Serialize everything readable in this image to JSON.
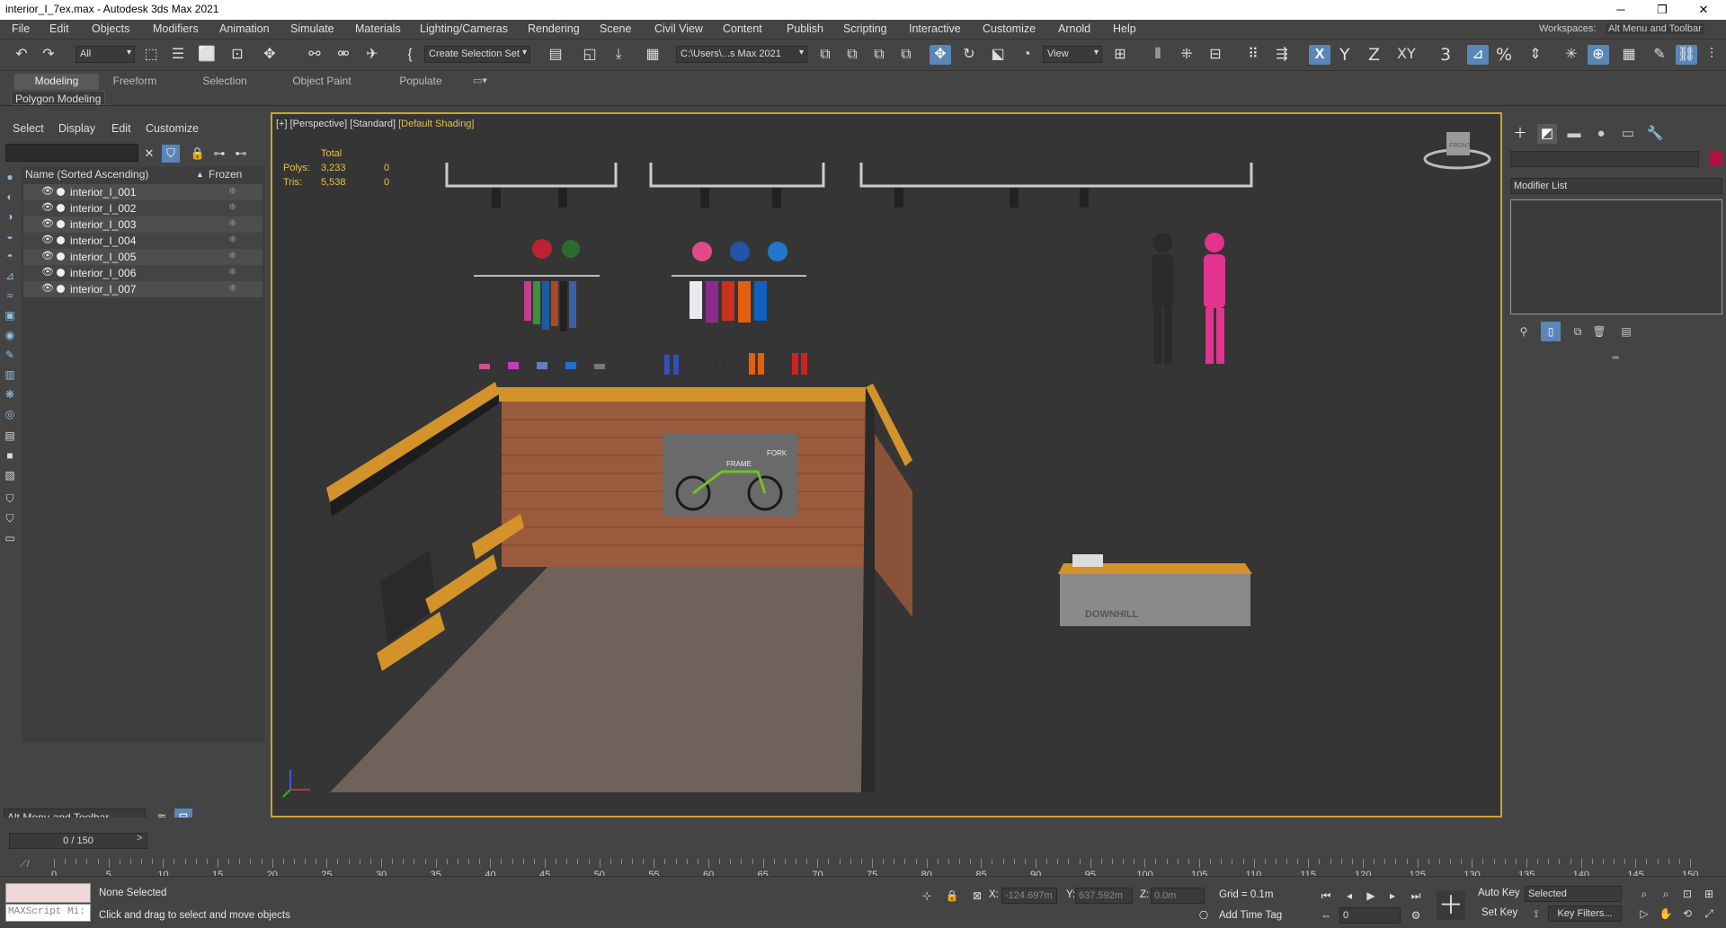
{
  "window": {
    "title": "interior_I_7ex.max - Autodesk 3ds Max 2021",
    "minimize": "─",
    "maximize": "❐",
    "close": "✕"
  },
  "menu": [
    "File",
    "Edit",
    "Objects",
    "Modifiers",
    "Animation",
    "Simulate",
    "Materials",
    "Lighting/Cameras",
    "Rendering",
    "Scene",
    "Civil View",
    "Content",
    "Publish",
    "Scripting",
    "Interactive",
    "Customize",
    "Arnold",
    "Help"
  ],
  "workspaces": {
    "label": "Workspaces:",
    "value": "Alt Menu and Toolbar"
  },
  "toolbar": {
    "filter": "All",
    "selection_set": "Create Selection Set",
    "path": "C:\\Users\\...s Max 2021",
    "ref_coord": "View",
    "axes": [
      "X",
      "Y",
      "Z",
      "XY"
    ],
    "snap_labels": [
      "3",
      "%"
    ]
  },
  "ribbon": {
    "tabs": [
      "Modeling",
      "Freeform",
      "Selection",
      "Object Paint",
      "Populate"
    ],
    "active_tab": "Modeling",
    "panel": "Polygon Modeling"
  },
  "explorer": {
    "menus": [
      "Select",
      "Display",
      "Edit",
      "Customize"
    ],
    "col_name": "Name (Sorted Ascending)",
    "col_frozen": "Frozen",
    "sort_marker": "▲",
    "objects": [
      "interior_I_001",
      "interior_I_002",
      "interior_I_003",
      "interior_I_004",
      "interior_I_005",
      "interior_I_006",
      "interior_I_007"
    ],
    "workspace_dd": "Alt Menu and Toolbar"
  },
  "viewport": {
    "label_plus": "[+]",
    "label_view": "[Perspective]",
    "label_std": "[Standard]",
    "label_shading": "[Default Shading]",
    "stats": {
      "header": "Total",
      "polys_label": "Polys:",
      "polys_total": "3,233",
      "polys_sel": "0",
      "tris_label": "Tris:",
      "tris_total": "5,538",
      "tris_sel": "0"
    },
    "counter_logo": "DOWNHILL",
    "board_labels": [
      "FRAME",
      "FORK"
    ],
    "cube_label": "FRONT"
  },
  "command_panel": {
    "modifier_list": "Modifier List",
    "color": "#b0123f"
  },
  "timeline": {
    "slider": "0 / 150",
    "ticks": [
      0,
      5,
      10,
      15,
      20,
      25,
      30,
      35,
      40,
      45,
      50,
      55,
      60,
      65,
      70,
      75,
      80,
      85,
      90,
      95,
      100,
      105,
      110,
      115,
      120,
      125,
      130,
      135,
      140,
      145,
      150
    ]
  },
  "status": {
    "selection": "None Selected",
    "prompt": "Click and drag to select and move objects",
    "maxscript": "MAXScript Mi:",
    "x_label": "X:",
    "x_value": "-124.697m",
    "y_label": "Y:",
    "y_value": "637.592m",
    "z_label": "Z:",
    "z_value": "0.0m",
    "grid": "Grid = 0.1m",
    "add_time_tag": "Add Time Tag",
    "auto_key": "Auto Key",
    "set_key": "Set Key",
    "selected_dd": "Selected",
    "key_filters": "Key Filters...",
    "frame": "0"
  }
}
